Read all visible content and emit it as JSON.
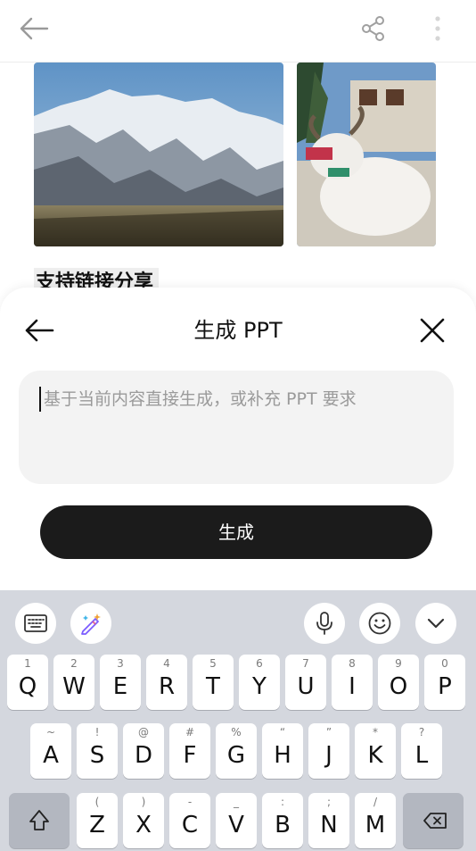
{
  "article": {
    "heading_partial": "支持链接分享"
  },
  "sheet": {
    "title": "生成 PPT",
    "prompt_placeholder": "基于当前内容直接生成，或补充 PPT 要求",
    "generate_label": "生成"
  },
  "keyboard": {
    "row1": [
      {
        "sub": "1",
        "key": "Q"
      },
      {
        "sub": "2",
        "key": "W"
      },
      {
        "sub": "3",
        "key": "E"
      },
      {
        "sub": "4",
        "key": "R"
      },
      {
        "sub": "5",
        "key": "T"
      },
      {
        "sub": "6",
        "key": "Y"
      },
      {
        "sub": "7",
        "key": "U"
      },
      {
        "sub": "8",
        "key": "I"
      },
      {
        "sub": "9",
        "key": "O"
      },
      {
        "sub": "0",
        "key": "P"
      }
    ],
    "row2": [
      {
        "sub": "~",
        "key": "A"
      },
      {
        "sub": "!",
        "key": "S"
      },
      {
        "sub": "@",
        "key": "D"
      },
      {
        "sub": "#",
        "key": "F"
      },
      {
        "sub": "%",
        "key": "G"
      },
      {
        "sub": "“",
        "key": "H"
      },
      {
        "sub": "”",
        "key": "J"
      },
      {
        "sub": "*",
        "key": "K"
      },
      {
        "sub": "?",
        "key": "L"
      }
    ],
    "row3": [
      {
        "sub": "(",
        "key": "Z"
      },
      {
        "sub": ")",
        "key": "X"
      },
      {
        "sub": "-",
        "key": "C"
      },
      {
        "sub": "_",
        "key": "V"
      },
      {
        "sub": ":",
        "key": "B"
      },
      {
        "sub": ";",
        "key": "N"
      },
      {
        "sub": "/",
        "key": "M"
      }
    ]
  },
  "icons": {
    "back": "arrow-left-icon",
    "share": "share-icon",
    "more": "more-vertical-icon",
    "close": "close-icon",
    "keyboard_layout": "keyboard-icon",
    "ai_pen": "magic-pen-icon",
    "mic": "microphone-icon",
    "emoji": "emoji-icon",
    "collapse": "chevron-down-icon",
    "shift": "shift-icon",
    "delete": "backspace-icon"
  },
  "colors": {
    "primary_button": "#1b1b1b",
    "keyboard_bg": "#d4d7de",
    "prompt_bg": "#f3f3f3"
  }
}
